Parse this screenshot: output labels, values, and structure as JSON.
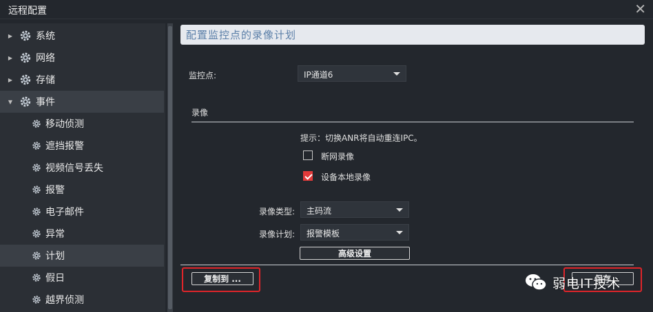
{
  "window": {
    "title": "远程配置"
  },
  "sidebar": {
    "items": [
      {
        "label": "系统",
        "level": 0,
        "expanded": false
      },
      {
        "label": "网络",
        "level": 0,
        "expanded": false
      },
      {
        "label": "存储",
        "level": 0,
        "expanded": false
      },
      {
        "label": "事件",
        "level": 0,
        "expanded": true
      },
      {
        "label": "移动侦测",
        "level": 1
      },
      {
        "label": "遮挡报警",
        "level": 1
      },
      {
        "label": "视频信号丢失",
        "level": 1
      },
      {
        "label": "报警",
        "level": 1
      },
      {
        "label": "电子邮件",
        "level": 1
      },
      {
        "label": "异常",
        "level": 1
      },
      {
        "label": "计划",
        "level": 1,
        "selected": true
      },
      {
        "label": "假日",
        "level": 1
      },
      {
        "label": "越界侦测",
        "level": 1
      }
    ]
  },
  "main": {
    "header": "配置监控点的录像计划",
    "monitor_label": "监控点:",
    "monitor_value": "IP通道6",
    "section_title": "录像",
    "tip": "提示：切换ANR将自动重连IPC。",
    "checkbox_network": {
      "label": "断网录像",
      "checked": false
    },
    "checkbox_local": {
      "label": "设备本地录像",
      "checked": true
    },
    "record_type_label": "录像类型:",
    "record_type_value": "主码流",
    "record_plan_label": "录像计划:",
    "record_plan_value": "报警模板",
    "advanced_button": "高级设置",
    "copy_button": "复制到 ...",
    "save_button": "保存"
  },
  "colors": {
    "background": "#23272d",
    "sidebar": "#2b2f35",
    "header_bg": "#e6e9ee",
    "header_text": "#5b7fa8",
    "check_red": "#e23a3a",
    "highlight_red": "#e1252a"
  },
  "watermark": {
    "text": "弱电IT技术"
  }
}
